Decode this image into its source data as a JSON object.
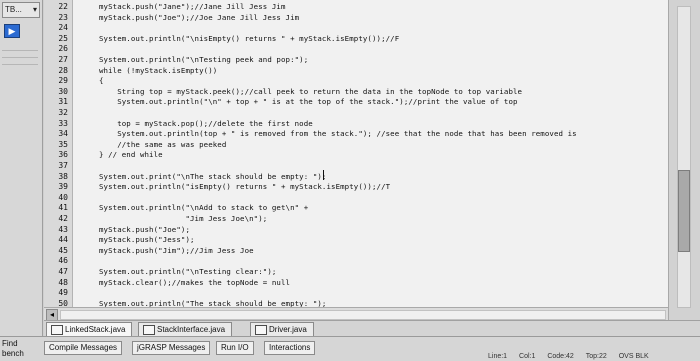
{
  "toolbar": {
    "top_left_label": "TB...",
    "top_left_arrow": "▾",
    "nav_button_label": "▶"
  },
  "editor": {
    "line_numbers": [
      "22",
      "23",
      "24",
      "25",
      "26",
      "27",
      "28",
      "29",
      "30",
      "31",
      "32",
      "33",
      "34",
      "35",
      "36",
      "37",
      "38",
      "39",
      "40",
      "41",
      "42",
      "43",
      "44",
      "45",
      "46",
      "47",
      "48",
      "49",
      "50"
    ],
    "lines": [
      "myStack.push(\"Jane\");//Jane Jill Jess Jim",
      "myStack.push(\"Joe\");//Joe Jane Jill Jess Jim",
      "",
      "System.out.println(\"\\nisEmpty() returns \" + myStack.isEmpty());//F",
      "",
      "System.out.println(\"\\nTesting peek and pop:\");",
      "while (!myStack.isEmpty())",
      "{",
      "    String top = myStack.peek();//call peek to return the data in the topNode to top variable",
      "    System.out.println(\"\\n\" + top + \" is at the top of the stack.\");//print the value of top",
      "",
      "    top = myStack.pop();//delete the first node",
      "    System.out.println(top + \" is removed from the stack.\"); //see that the node that has been removed is",
      "    //the same as was peeked",
      "} // end while",
      "",
      "System.out.print(\"\\nThe stack should be empty: \");",
      "System.out.println(\"isEmpty() returns \" + myStack.isEmpty());//T",
      "",
      "System.out.println(\"\\nAdd to stack to get\\n\" +",
      "                   \"Jim Jess Joe\\n\");",
      "myStack.push(\"Joe\");",
      "myStack.push(\"Jess\");",
      "myStack.push(\"Jim\");//Jim Jess Joe",
      "",
      "System.out.println(\"\\nTesting clear:\");",
      "myStack.clear();//makes the topNode = null",
      "",
      "System.out.println(\"The stack should be empty: \");"
    ]
  },
  "file_tabs": [
    {
      "label": "LinkedStack.java"
    },
    {
      "label": "StackInterface.java"
    },
    {
      "label": "Driver.java"
    }
  ],
  "bottom": {
    "find_label_1": "Find",
    "find_label_2": "bench",
    "tabs": [
      {
        "label": "Compile Messages"
      },
      {
        "label": "jGRASP Messages"
      },
      {
        "label": "Run I/O"
      },
      {
        "label": "Interactions"
      }
    ],
    "status": {
      "line": "Line:1",
      "col": "Col:1",
      "code": "Code:42",
      "top": "Top:22",
      "mode": "OVS BLK"
    }
  },
  "colors": {
    "editor_bg": "#f1f1f1",
    "gutter_bg": "#d9d9d9",
    "chrome_bg": "#cfcfcf",
    "accent_button": "#2b6ad1"
  }
}
